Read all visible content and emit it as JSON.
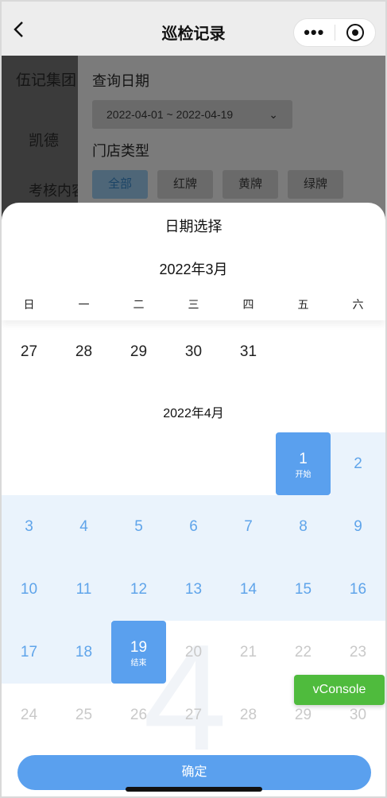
{
  "nav": {
    "back_icon": "chevron-left-icon",
    "title": "巡检记录",
    "more_icon": "more-dots-icon",
    "target_icon": "target-icon"
  },
  "background": {
    "left_items": [
      "伍记集团",
      "凯德",
      "考核内容"
    ],
    "query_date_label": "查询日期",
    "date_range": "2022-04-01 ~ 2022-04-19",
    "store_type_label": "门店类型",
    "store_types": [
      "全部",
      "红牌",
      "黄牌",
      "绿牌"
    ],
    "active_store_type": "全部"
  },
  "picker": {
    "title": "日期选择",
    "weekdays": [
      "日",
      "一",
      "二",
      "三",
      "四",
      "五",
      "六"
    ],
    "month1": {
      "label": "2022年3月",
      "days": [
        "27",
        "28",
        "29",
        "30",
        "31"
      ]
    },
    "month2": {
      "label": "2022年4月",
      "watermark": "4",
      "rows": [
        [
          "",
          "",
          "",
          "",
          "",
          "1",
          "2"
        ],
        [
          "3",
          "4",
          "5",
          "6",
          "7",
          "8",
          "9"
        ],
        [
          "10",
          "11",
          "12",
          "13",
          "14",
          "15",
          "16"
        ],
        [
          "17",
          "18",
          "19",
          "20",
          "21",
          "22",
          "23"
        ],
        [
          "24",
          "25",
          "26",
          "27",
          "28",
          "29",
          "30"
        ]
      ],
      "start_day": "1",
      "start_label": "开始",
      "end_day": "19",
      "end_label": "结束"
    },
    "confirm_label": "确定"
  },
  "vconsole_label": "vConsole",
  "colors": {
    "accent": "#5aa0ee",
    "range_bg": "#eaf3fc",
    "range_text": "#5fa4ea",
    "disabled_text": "#c9c9c9",
    "vconsole": "#4fbb3d"
  }
}
